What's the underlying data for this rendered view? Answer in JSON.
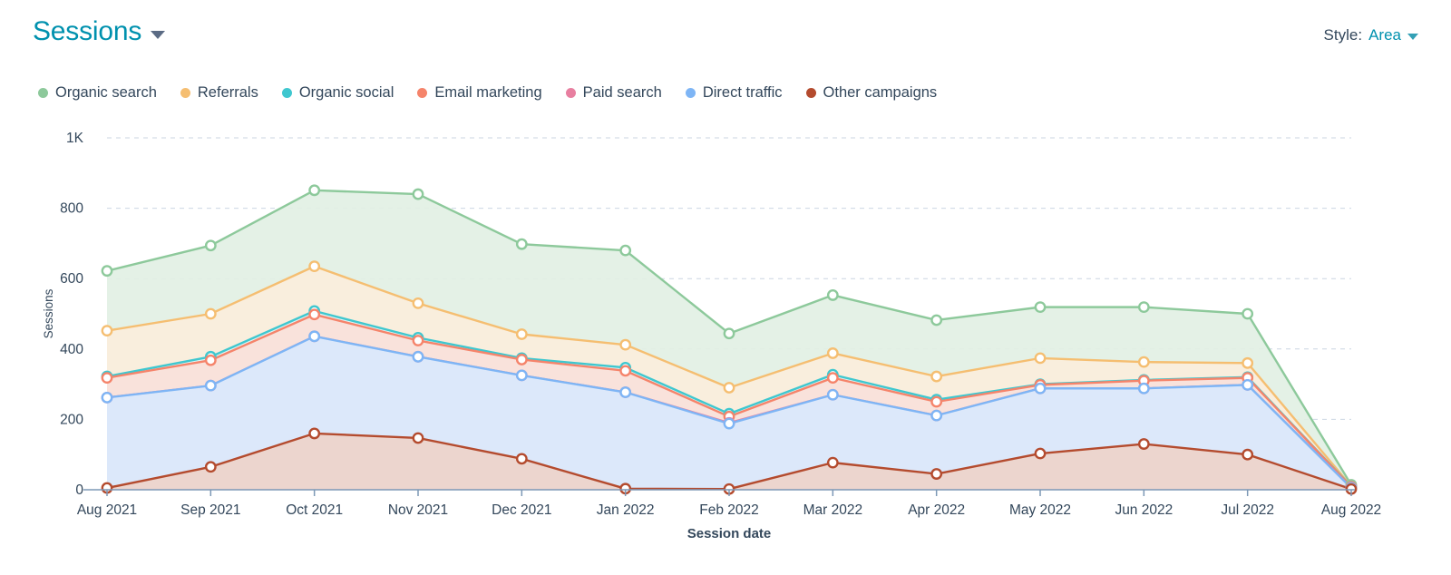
{
  "header": {
    "title": "Sessions",
    "title_caret_icon": "chevron-down-icon",
    "style_label": "Style:",
    "style_value": "Area",
    "style_caret_icon": "chevron-down-icon"
  },
  "chart_data": {
    "type": "area",
    "title": "Sessions",
    "xlabel": "Session date",
    "ylabel": "Sessions",
    "categories": [
      "Aug 2021",
      "Sep 2021",
      "Oct 2021",
      "Nov 2021",
      "Dec 2021",
      "Jan 2022",
      "Feb 2022",
      "Mar 2022",
      "Apr 2022",
      "May 2022",
      "Jun 2022",
      "Jul 2022",
      "Aug 2022"
    ],
    "ylim": [
      0,
      1000
    ],
    "ytick_values": [
      0,
      200,
      400,
      600,
      800,
      1000
    ],
    "ytick_labels": [
      "0",
      "200",
      "400",
      "600",
      "800",
      "1K"
    ],
    "grid": true,
    "legend_position": "top-left",
    "stacked": false,
    "series": [
      {
        "name": "Organic search",
        "color": "#8DC99B",
        "fill": "#e2f0e4",
        "values": [
          622,
          694,
          851,
          840,
          698,
          680,
          444,
          553,
          482,
          519,
          519,
          500,
          14
        ]
      },
      {
        "name": "Referrals",
        "color": "#F5BE71",
        "fill": "#fbeedc",
        "values": [
          452,
          500,
          635,
          530,
          442,
          412,
          290,
          388,
          322,
          374,
          363,
          360,
          10
        ]
      },
      {
        "name": "Organic social",
        "color": "#3FC7CF",
        "fill": "#ddf4f5",
        "values": [
          322,
          378,
          508,
          432,
          374,
          347,
          216,
          327,
          256,
          300,
          312,
          320,
          9
        ]
      },
      {
        "name": "Email marketing",
        "color": "#F5846B",
        "fill": "#fbdfd8",
        "values": [
          318,
          368,
          498,
          424,
          370,
          338,
          208,
          318,
          250,
          298,
          310,
          318,
          8
        ]
      },
      {
        "name": "Paid search",
        "color": "#E87FA0",
        "fill": "#f9e2e9",
        "values": [
          262,
          296,
          436,
          378,
          325,
          277,
          190,
          270,
          211,
          288,
          288,
          298,
          6
        ]
      },
      {
        "name": "Direct traffic",
        "color": "#7EB5F5",
        "fill": "#d9e8fb",
        "values": [
          262,
          296,
          436,
          378,
          325,
          277,
          188,
          270,
          211,
          288,
          288,
          298,
          5
        ]
      },
      {
        "name": "Other campaigns",
        "color": "#B44B2E",
        "fill": "#edd2ca",
        "values": [
          5,
          65,
          160,
          147,
          88,
          3,
          2,
          77,
          45,
          103,
          130,
          100,
          2
        ]
      }
    ]
  },
  "colors": {
    "title": "#0091ae",
    "text": "#33475b",
    "grid": "#cbd6e2",
    "axis": "#7c98b6"
  }
}
